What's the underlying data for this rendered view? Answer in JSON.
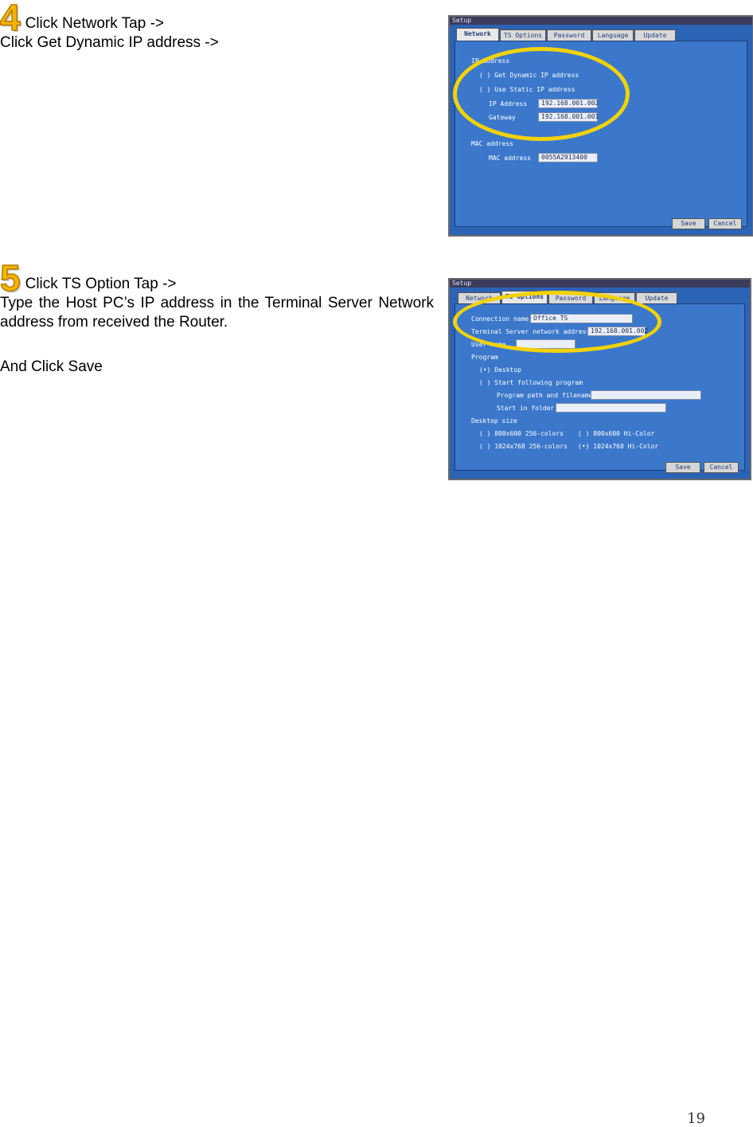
{
  "step4": {
    "number": "4",
    "line1": "Click Network Tap ->",
    "line2": "Click Get Dynamic IP address ->"
  },
  "step5": {
    "number": "5",
    "line1": "Click TS Option Tap ->",
    "para": "Type the Host PC’s IP address in the Terminal Server Network address from received the Router.",
    "line3": "And Click Save"
  },
  "shot1": {
    "window_title": "Setup",
    "tabs": [
      "Network",
      "TS Options",
      "Password",
      "Language",
      "Update"
    ],
    "ip_section": "IP address",
    "opt_dynamic": "( ) Get Dynamic IP address",
    "opt_static": "( ) Use Static IP address",
    "ip_label": "IP Address",
    "ip_value": "192.168.001.002",
    "gw_label": "Gateway",
    "gw_value": "192.168.001.001",
    "mac_section": "MAC address",
    "mac_label": "MAC address",
    "mac_value": "0055A2913400",
    "save": "Save",
    "cancel": "Cancel"
  },
  "shot2": {
    "window_title": "Setup",
    "tabs": [
      "Network",
      "TS Options",
      "Password",
      "Language",
      "Update"
    ],
    "conn_label": "Connection name",
    "conn_value": "Office TS",
    "ts_label": "Terminal Server network address",
    "ts_value": "192.168.001.002",
    "user_label": "User name",
    "program_section": "Program",
    "opt_desktop": "(•) Desktop",
    "opt_start": "( ) Start following program",
    "path_label": "Program path and filename",
    "folder_label": "Start in folder",
    "desktop_size": "Desktop size",
    "res1": "( ) 800x600 256-colors",
    "res2": "( ) 800x600 Hi-Color",
    "res3": "( ) 1024x768 256-colors",
    "res4": "(•) 1024x768 Hi-Color",
    "save": "Save",
    "cancel": "Cancel"
  },
  "page_number": "19",
  "colors": {
    "highlight_ring": "#f2d20a",
    "step_number": "#f5b400",
    "dialog_blue": "#3b78cc"
  }
}
